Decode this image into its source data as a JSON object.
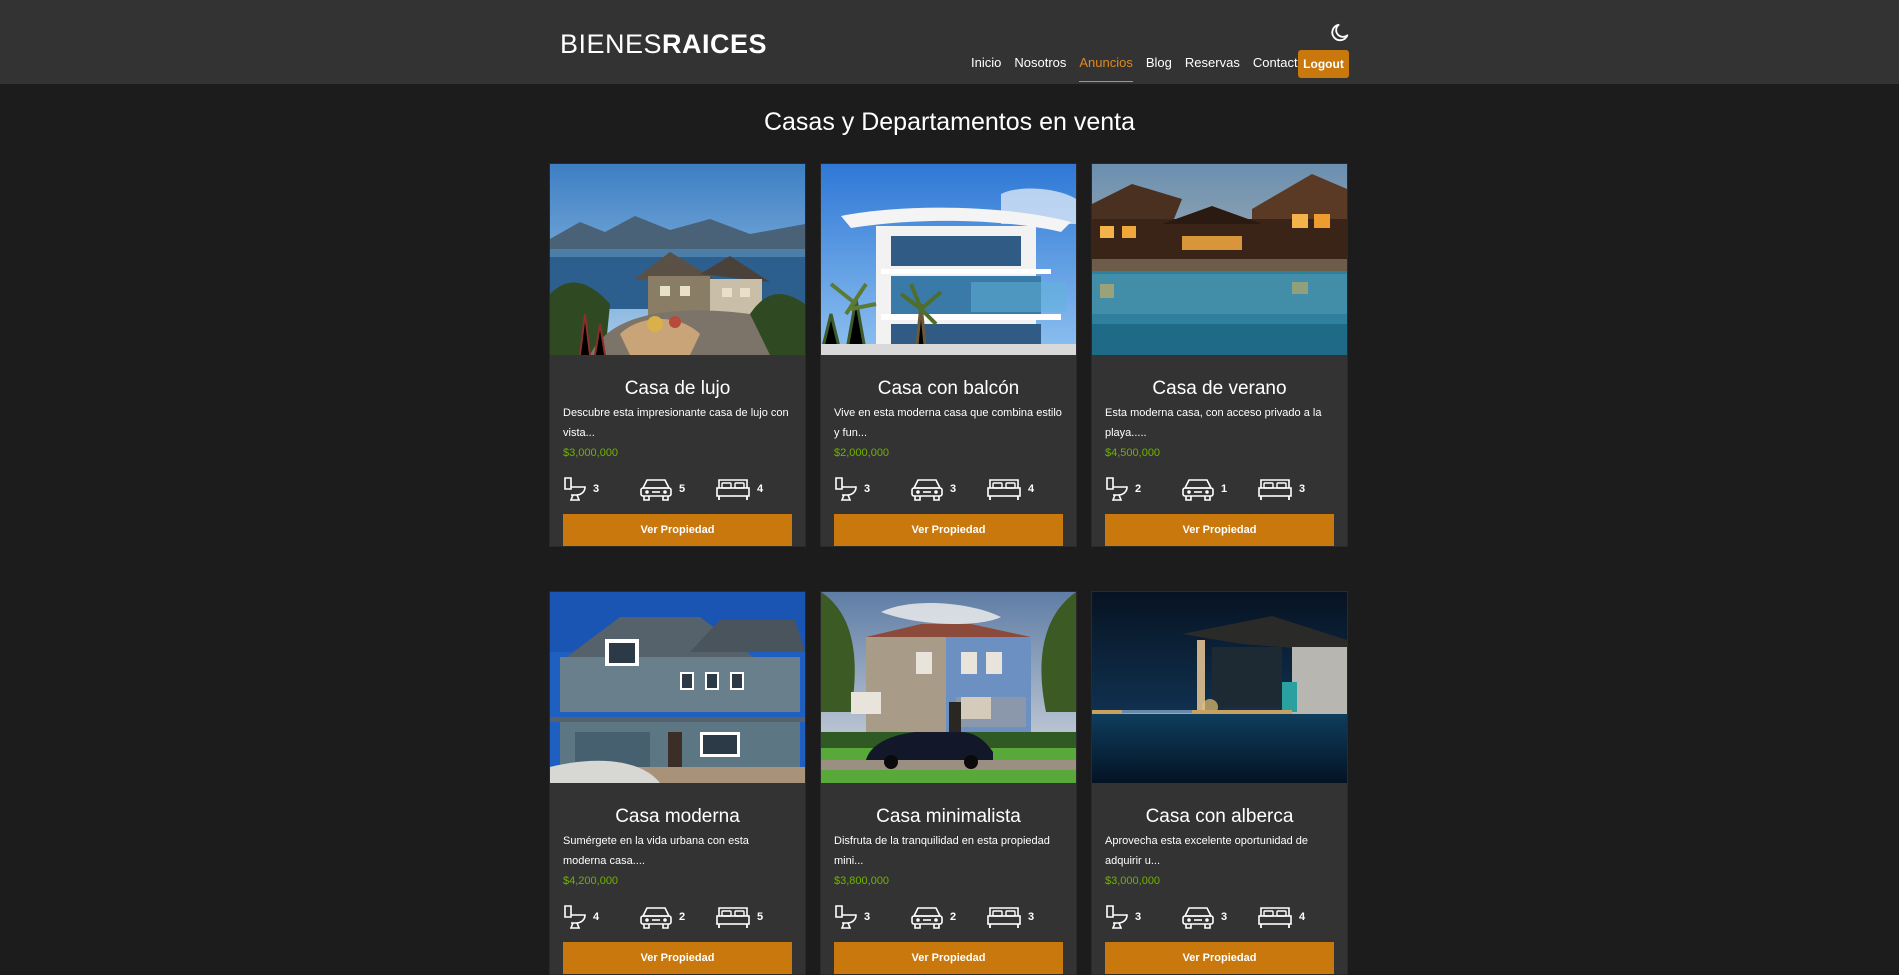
{
  "header": {
    "logo_light": "BIENES",
    "logo_bold": "RAICES",
    "nav": [
      {
        "label": "Inicio",
        "active": false
      },
      {
        "label": "Nosotros",
        "active": false
      },
      {
        "label": "Anuncios",
        "active": true
      },
      {
        "label": "Blog",
        "active": false
      },
      {
        "label": "Reservas",
        "active": false
      },
      {
        "label": "Contacto",
        "active": false
      }
    ],
    "logout_label": "Logout",
    "theme_icon": "moon-icon"
  },
  "main": {
    "title": "Casas y Departamentos en venta",
    "view_label": "Ver Propiedad",
    "listings": [
      {
        "title": "Casa de lujo",
        "desc": "Descubre esta impresionante casa de lujo con vista...",
        "price": "$3,000,000",
        "baths": "3",
        "parking": "5",
        "beds": "4",
        "photo": "lakeside-house"
      },
      {
        "title": "Casa con balcón",
        "desc": "Vive en esta moderna casa que combina estilo y fun...",
        "price": "$2,000,000",
        "baths": "3",
        "parking": "3",
        "beds": "4",
        "photo": "modern-balcony-house"
      },
      {
        "title": "Casa de verano",
        "desc": "Esta moderna casa, con acceso privado a la playa.....",
        "price": "$4,500,000",
        "baths": "2",
        "parking": "1",
        "beds": "3",
        "photo": "lodge-with-pool"
      },
      {
        "title": "Casa moderna",
        "desc": "Sumérgete en la vida urbana con esta moderna casa....",
        "price": "$4,200,000",
        "baths": "4",
        "parking": "2",
        "beds": "5",
        "photo": "blue-suburban-house"
      },
      {
        "title": "Casa minimalista",
        "desc": "Disfruta de la tranquilidad en esta propiedad mini...",
        "price": "$3,800,000",
        "baths": "3",
        "parking": "2",
        "beds": "3",
        "photo": "brick-house-with-car"
      },
      {
        "title": "Casa con alberca",
        "desc": "Aprovecha esta excelente oportunidad de adquirir u...",
        "price": "$3,000,000",
        "baths": "3",
        "parking": "3",
        "beds": "4",
        "photo": "night-house-with-pool"
      }
    ]
  },
  "colors": {
    "accent": "#c8780c",
    "price": "#71b100",
    "header_bg": "#333333",
    "page_bg": "#1c1c1c",
    "card_bg": "#333333"
  },
  "icons": {
    "bath": "toilet-icon",
    "parking": "car-icon",
    "beds": "bed-icon"
  }
}
